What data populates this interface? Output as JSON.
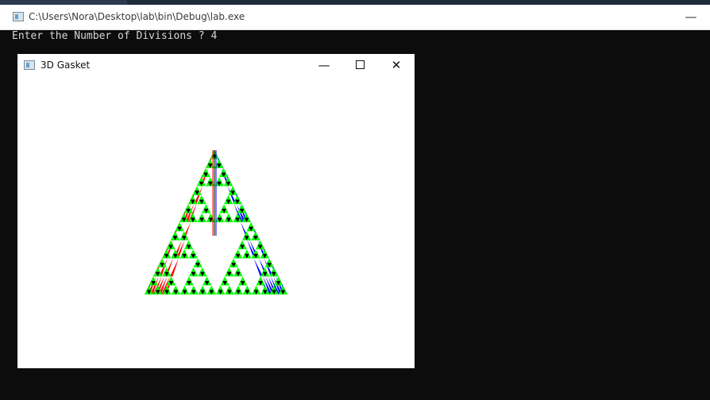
{
  "console": {
    "title": "C:\\Users\\Nora\\Desktop\\lab\\bin\\Debug\\lab.exe",
    "minimize_glyph": "—",
    "lines": [
      "Enter the Number of Divisions ? 4"
    ]
  },
  "gl_window": {
    "title": "3D Gasket",
    "minimize_glyph": "—",
    "close_glyph": "✕"
  },
  "gasket": {
    "divisions": 4,
    "face_colors": {
      "red": "#ff0000",
      "green": "#00ff00",
      "blue": "#0000ff",
      "black": "#000000"
    },
    "background": "#ffffff"
  },
  "colors": {
    "console_bg": "#0c0c0c",
    "console_text": "#d8d8d8",
    "titlebar_bg": "#ffffff"
  }
}
